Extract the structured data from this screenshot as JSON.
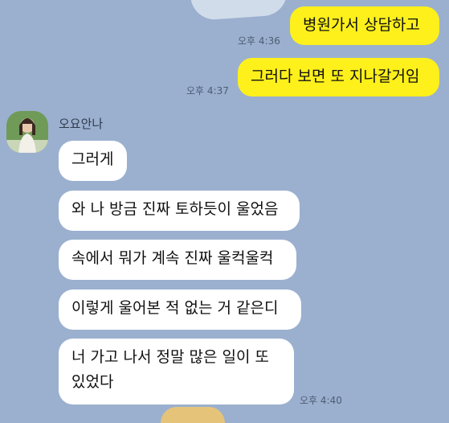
{
  "messages_outgoing": [
    {
      "text": "병원가서 상담하고",
      "time": "오후 4:36"
    },
    {
      "text": "그러다 보면 또 지나갈거임",
      "time": "오후 4:37"
    }
  ],
  "incoming": {
    "sender": "오요안나",
    "messages": [
      {
        "text": "그러게"
      },
      {
        "text": "와 나 방금 진짜 토하듯이 울었음"
      },
      {
        "text": "속에서 뭐가 계속 진짜 울컥울컥"
      },
      {
        "text": "이렇게 울어본 적 없는 거 같은디"
      },
      {
        "line1": "너 가고 나서 정말 많은 일이 또",
        "line2": "있었다",
        "time": "오후 4:40"
      }
    ]
  },
  "colors": {
    "background": "#9bb0cf",
    "my_bubble": "#fef01b",
    "their_bubble": "#ffffff"
  },
  "icons": {
    "avatar": "profile-photo"
  }
}
